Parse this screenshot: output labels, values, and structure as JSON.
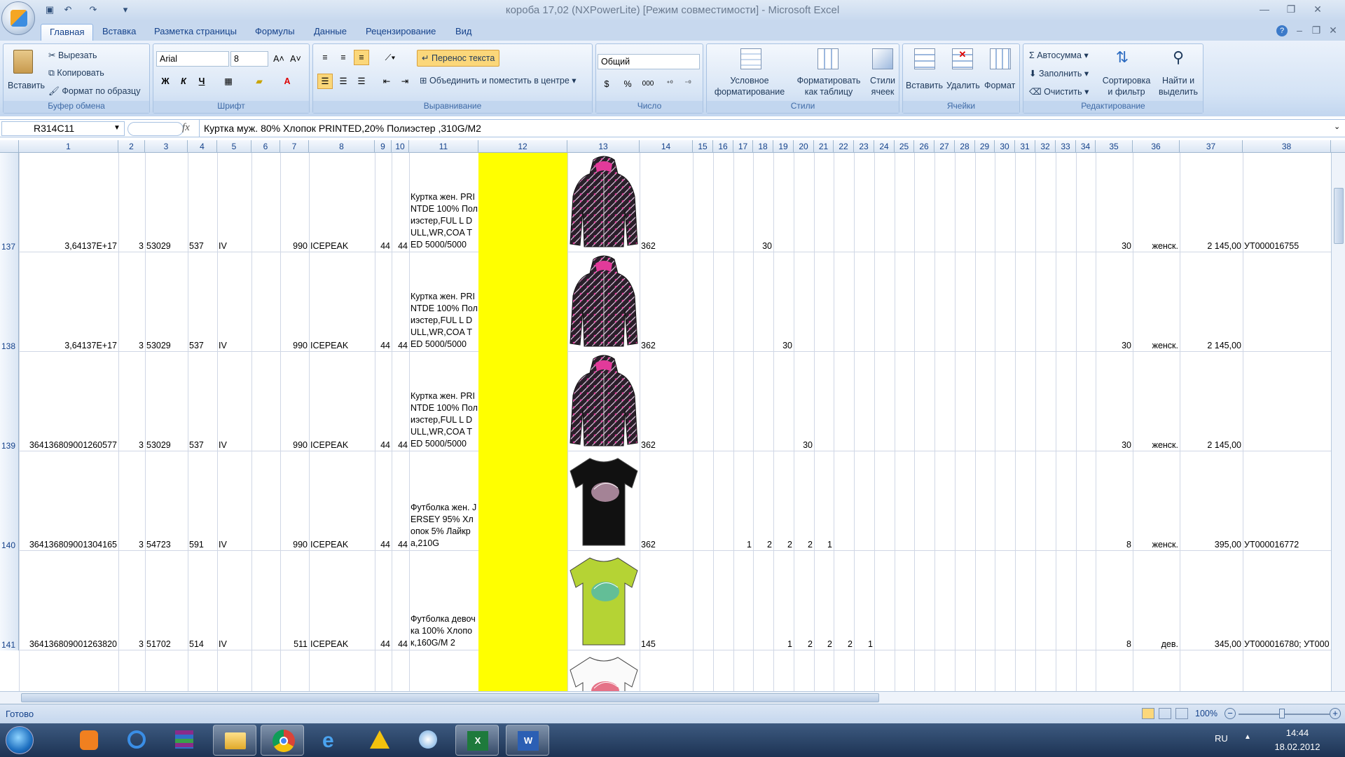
{
  "window": {
    "title": "короба 17,02 (NXPowerLite)  [Режим совместимости] - Microsoft Excel"
  },
  "tabs": [
    "Главная",
    "Вставка",
    "Разметка страницы",
    "Формулы",
    "Данные",
    "Рецензирование",
    "Вид"
  ],
  "ribbon": {
    "clipboard": {
      "paste": "Вставить",
      "cut": "Вырезать",
      "copy": "Копировать",
      "format_painter": "Формат по образцу",
      "label": "Буфер обмена"
    },
    "font": {
      "name": "Arial",
      "size": "8",
      "label": "Шрифт",
      "bold": "Ж",
      "italic": "К",
      "underline": "Ч"
    },
    "alignment": {
      "wrap": "Перенос текста",
      "merge": "Объединить и поместить в центре",
      "label": "Выравнивание"
    },
    "number": {
      "format": "Общий",
      "label": "Число",
      "currency": "$",
      "percent": "%",
      "thousands": "000"
    },
    "styles": {
      "conditional": "Условное форматирование",
      "as_table": "Форматировать как таблицу",
      "cell_styles": "Стили ячеек",
      "label": "Стили"
    },
    "cells": {
      "insert": "Вставить",
      "delete": "Удалить",
      "format": "Формат",
      "label": "Ячейки"
    },
    "editing": {
      "autosum": "Автосумма",
      "fill": "Заполнить",
      "clear": "Очистить",
      "sort": "Сортировка и фильтр",
      "find": "Найти и выделить",
      "label": "Редактирование"
    }
  },
  "formula_bar": {
    "name_box": "R314C11",
    "fx": "fx",
    "content": "Куртка муж. 80% Хлопок PRINTED,20% Полиэстер ,310G/M2"
  },
  "columns": [
    "1",
    "2",
    "3",
    "4",
    "5",
    "6",
    "7",
    "8",
    "9",
    "10",
    "11",
    "12",
    "13",
    "14",
    "15",
    "16",
    "17",
    "18",
    "19",
    "20",
    "21",
    "22",
    "23",
    "24",
    "25",
    "26",
    "27",
    "28",
    "29",
    "30",
    "31",
    "32",
    "33",
    "34",
    "35",
    "36",
    "37",
    "38"
  ],
  "rows": [
    {
      "num": "137",
      "c1": "3,64137E+17",
      "c2": "3",
      "c3": "53029",
      "c4": "537",
      "c5": "IV",
      "c7": "990",
      "c8": "ICEPEAK",
      "c9": "44",
      "c10": "44",
      "c11": "Куртка жен. PRINTDE 100% Полиэстер,FUL L DULL,WR,COA TED 5000/5000",
      "c14": "362",
      "sizes": {
        "18": "30"
      },
      "c35": "30",
      "c36": "женск.",
      "c37": "2 145,00",
      "c38": "УТ000016755"
    },
    {
      "num": "138",
      "c1": "3,64137E+17",
      "c2": "3",
      "c3": "53029",
      "c4": "537",
      "c5": "IV",
      "c7": "990",
      "c8": "ICEPEAK",
      "c9": "44",
      "c10": "44",
      "c11": "Куртка жен. PRINTDE 100% Полиэстер,FUL L DULL,WR,COA TED 5000/5000",
      "c14": "362",
      "sizes": {
        "19": "30"
      },
      "c35": "30",
      "c36": "женск.",
      "c37": "2 145,00",
      "c38": ""
    },
    {
      "num": "139",
      "c1": "364136809001260577",
      "c2": "3",
      "c3": "53029",
      "c4": "537",
      "c5": "IV",
      "c7": "990",
      "c8": "ICEPEAK",
      "c9": "44",
      "c10": "44",
      "c11": "Куртка жен. PRINTDE 100% Полиэстер,FUL L DULL,WR,COA TED 5000/5000",
      "c14": "362",
      "sizes": {
        "20": "30"
      },
      "c35": "30",
      "c36": "женск.",
      "c37": "2 145,00",
      "c38": ""
    },
    {
      "num": "140",
      "c1": "364136809001304165",
      "c2": "3",
      "c3": "54723",
      "c4": "591",
      "c5": "IV",
      "c7": "990",
      "c8": "ICEPEAK",
      "c9": "44",
      "c10": "44",
      "c11": "Футболка жен. JERSEY 95% Хлопок 5% Лайкра,210G",
      "c14": "362",
      "sizes": {
        "17": "1",
        "18": "2",
        "19": "2",
        "20": "2",
        "21": "1"
      },
      "c35": "8",
      "c36": "женск.",
      "c37": "395,00",
      "c38": "УТ000016772"
    },
    {
      "num": "141",
      "c1": "364136809001263820",
      "c2": "3",
      "c3": "51702",
      "c4": "514",
      "c5": "IV",
      "c7": "511",
      "c8": "ICEPEAK",
      "c9": "44",
      "c10": "44",
      "c11": "Футболка девочка 100% Хлопок,160G/M 2",
      "c14": "145",
      "sizes": {
        "19": "1",
        "20": "2",
        "21": "2",
        "22": "2",
        "23": "1"
      },
      "c35": "8",
      "c36": "дев.",
      "c37": "345,00",
      "c38": "УТ000016780; УТ000"
    }
  ],
  "status": {
    "ready": "Готово",
    "zoom": "100%"
  },
  "taskbar": {
    "lang": "RU",
    "time": "14:44",
    "date": "18.02.2012"
  },
  "icons": [
    "office-button-icon",
    "save-icon",
    "undo-icon",
    "redo-icon",
    "paste-icon",
    "scissors-icon",
    "copy-icon",
    "brush-icon",
    "wrap-text-icon",
    "merge-icon",
    "conditional-format-icon",
    "table-format-icon",
    "cell-styles-icon",
    "insert-cells-icon",
    "delete-cells-icon",
    "format-cells-icon",
    "sigma-icon",
    "sort-filter-icon",
    "binoculars-icon",
    "fx-icon"
  ]
}
